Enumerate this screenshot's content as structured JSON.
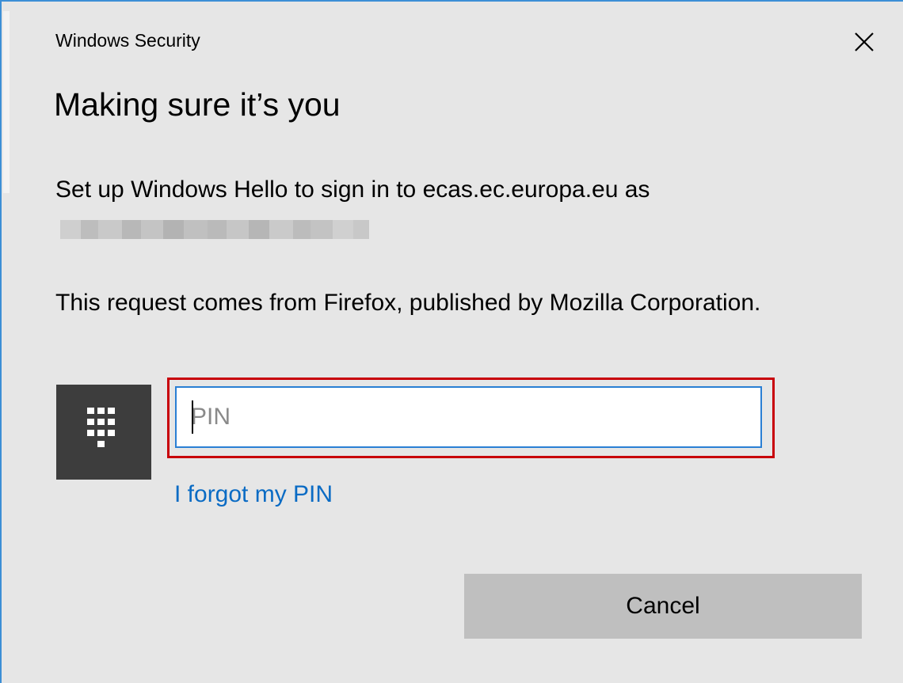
{
  "window": {
    "title": "Windows Security",
    "close_icon": "close-icon"
  },
  "content": {
    "heading": "Making sure it’s you",
    "message": "Set up Windows Hello to sign in to ecas.ec.europa.eu as",
    "request": "This request comes from Firefox, published by Mozilla Corporation."
  },
  "pin": {
    "icon": "keypad-icon",
    "value": "",
    "placeholder": "PIN",
    "forgot_link": "I forgot my PIN"
  },
  "actions": {
    "cancel_label": "Cancel"
  },
  "colors": {
    "dialog_background": "#e6e6e6",
    "link": "#0a6bc4",
    "focus_outline": "#c8000a",
    "input_border": "#2a7fd4",
    "pin_tile": "#3d3d3d",
    "button": "#bfbfbf"
  }
}
